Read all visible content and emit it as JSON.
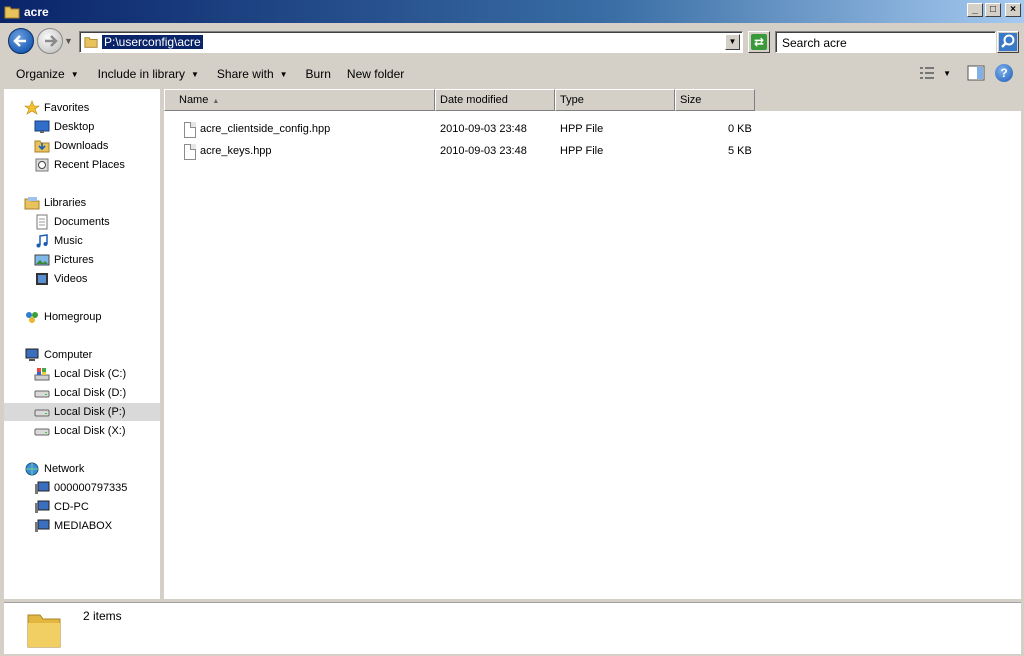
{
  "window": {
    "title": "acre"
  },
  "address_bar": {
    "path": "P:\\userconfig\\acre"
  },
  "search": {
    "placeholder": "Search acre"
  },
  "command_bar": {
    "organize": "Organize",
    "include_in_library": "Include in library",
    "share_with": "Share with",
    "burn": "Burn",
    "new_folder": "New folder"
  },
  "nav_pane": {
    "favorites": {
      "label": "Favorites",
      "items": [
        "Desktop",
        "Downloads",
        "Recent Places"
      ]
    },
    "libraries": {
      "label": "Libraries",
      "items": [
        "Documents",
        "Music",
        "Pictures",
        "Videos"
      ]
    },
    "homegroup": {
      "label": "Homegroup"
    },
    "computer": {
      "label": "Computer",
      "items": [
        "Local Disk (C:)",
        "Local Disk (D:)",
        "Local Disk (P:)",
        "Local Disk (X:)"
      ],
      "selected": "Local Disk (P:)"
    },
    "network": {
      "label": "Network",
      "items": [
        "000000797335",
        "CD-PC",
        "MEDIABOX"
      ]
    }
  },
  "columns": [
    "Name",
    "Date modified",
    "Type",
    "Size"
  ],
  "files": [
    {
      "name": "acre_clientside_config.hpp",
      "date": "2010-09-03 23:48",
      "type": "HPP File",
      "size": "0 KB"
    },
    {
      "name": "acre_keys.hpp",
      "date": "2010-09-03 23:48",
      "type": "HPP File",
      "size": "5 KB"
    }
  ],
  "details": {
    "items_count": "2 items"
  },
  "colors": {
    "title_bar": "#0a246a",
    "selection": "#0a246a",
    "nav_selected": "#d9d9d9"
  }
}
